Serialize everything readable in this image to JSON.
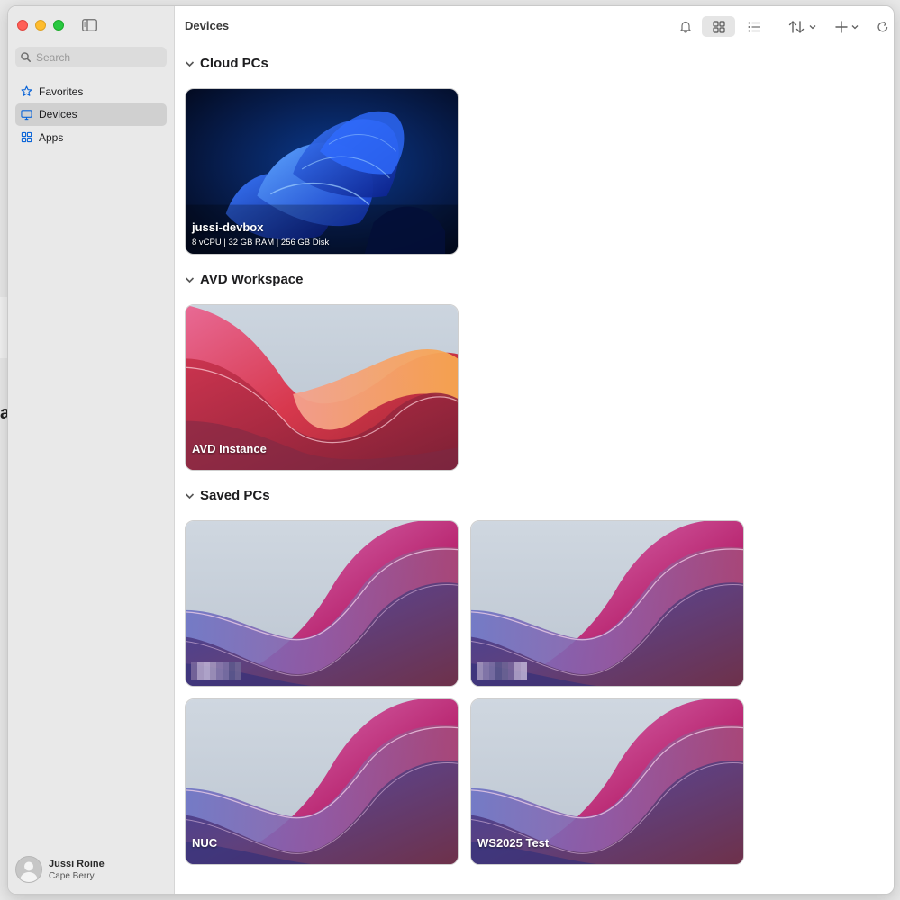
{
  "window": {
    "title": "Devices"
  },
  "sidebar": {
    "search_placeholder": "Search",
    "items": [
      {
        "label": "Favorites",
        "icon": "star-icon"
      },
      {
        "label": "Devices",
        "icon": "monitor-icon",
        "active": true
      },
      {
        "label": "Apps",
        "icon": "apps-grid-icon"
      }
    ],
    "user": {
      "name": "Jussi Roine",
      "org": "Cape Berry"
    }
  },
  "toolbar": {
    "icons": [
      "bell-icon",
      "grid-view-icon",
      "list-view-icon",
      "sort-icon",
      "add-icon",
      "refresh-icon"
    ]
  },
  "sections": [
    {
      "title": "Cloud PCs",
      "cards": [
        {
          "name": "jussi-devbox",
          "specs": "8 vCPU | 32 GB RAM | 256 GB Disk",
          "wallpaper": "windows-bloom-blue"
        }
      ]
    },
    {
      "title": "AVD Workspace",
      "cards": [
        {
          "name": "AVD Instance",
          "wallpaper": "red-orange-waves"
        }
      ]
    },
    {
      "title": "Saved PCs",
      "cards": [
        {
          "name": "",
          "redacted": true,
          "wallpaper": "purple-pink-waves"
        },
        {
          "name": "",
          "redacted": true,
          "wallpaper": "purple-pink-waves"
        },
        {
          "name": "NUC",
          "wallpaper": "purple-pink-waves"
        },
        {
          "name": "WS2025 Test",
          "wallpaper": "purple-pink-waves"
        }
      ]
    }
  ],
  "colors": {
    "accent": "#0a64d8",
    "sidebar_bg": "#e9e9e9",
    "selected_bg": "#d0d0d0"
  }
}
